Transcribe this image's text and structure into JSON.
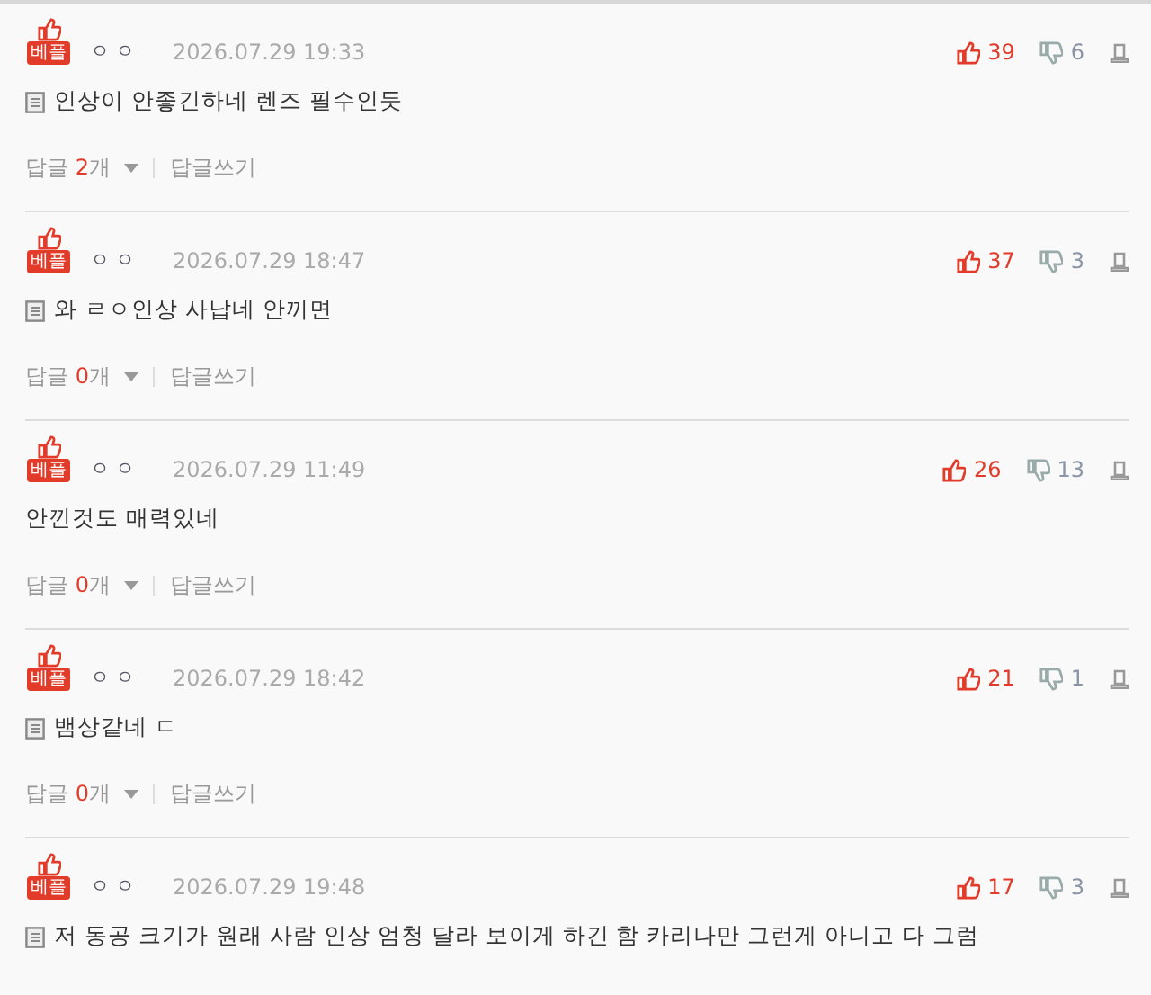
{
  "comments": [
    {
      "badge": "베플",
      "nickname": "ㅇㅇ",
      "date": "2026.07.29 19:33",
      "has_attachment": true,
      "text": "인상이 안좋긴하네 렌즈 필수인듯",
      "likes": "39",
      "dislikes": "6",
      "reply_label": "답글",
      "reply_count": "2",
      "reply_unit": "개",
      "write_reply": "답글쓰기"
    },
    {
      "badge": "베플",
      "nickname": "ㅇㅇ",
      "date": "2026.07.29 18:47",
      "has_attachment": true,
      "text": "와 ㄹㅇ인상 사납네 안끼면",
      "likes": "37",
      "dislikes": "3",
      "reply_label": "답글",
      "reply_count": "0",
      "reply_unit": "개",
      "write_reply": "답글쓰기"
    },
    {
      "badge": "베플",
      "nickname": "ㅇㅇ",
      "date": "2026.07.29 11:49",
      "has_attachment": false,
      "text": "안낀것도 매력있네",
      "likes": "26",
      "dislikes": "13",
      "reply_label": "답글",
      "reply_count": "0",
      "reply_unit": "개",
      "write_reply": "답글쓰기"
    },
    {
      "badge": "베플",
      "nickname": "ㅇㅇ",
      "date": "2026.07.29 18:42",
      "has_attachment": true,
      "text": "뱀상같네 ㄷ",
      "likes": "21",
      "dislikes": "1",
      "reply_label": "답글",
      "reply_count": "0",
      "reply_unit": "개",
      "write_reply": "답글쓰기"
    },
    {
      "badge": "베플",
      "nickname": "ㅇㅇ",
      "date": "2026.07.29 19:48",
      "has_attachment": true,
      "text": "저 동공 크기가 원래 사람 인상 엄청 달라 보이게 하긴 함 카리나만 그런게 아니고 다 그럼",
      "likes": "17",
      "dislikes": "3"
    }
  ]
}
